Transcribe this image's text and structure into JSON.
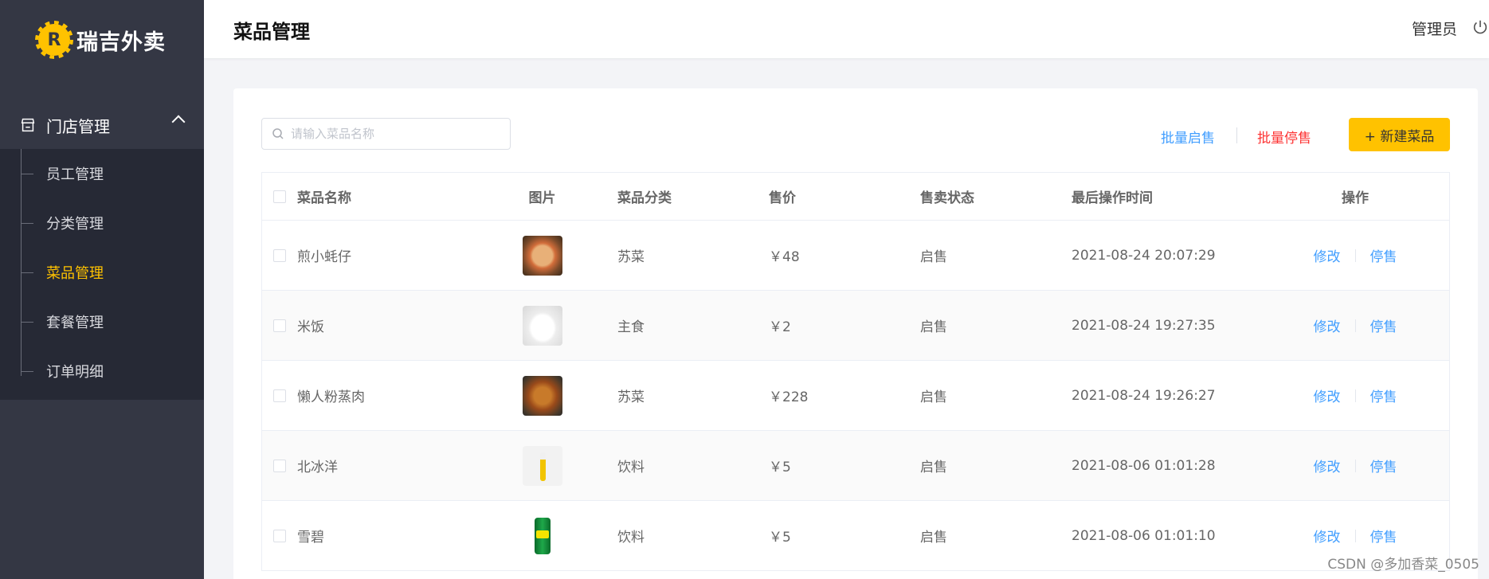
{
  "brand": {
    "logo_char": "R",
    "name": "瑞吉外卖"
  },
  "sidebar": {
    "group_label": "门店管理",
    "items": [
      {
        "label": "员工管理",
        "active": false
      },
      {
        "label": "分类管理",
        "active": false
      },
      {
        "label": "菜品管理",
        "active": true
      },
      {
        "label": "套餐管理",
        "active": false
      },
      {
        "label": "订单明细",
        "active": false
      }
    ]
  },
  "header": {
    "title": "菜品管理",
    "user": "管理员"
  },
  "toolbar": {
    "search_placeholder": "请输入菜品名称",
    "batch_enable": "批量启售",
    "batch_disable": "批量停售",
    "new_button": "+ 新建菜品"
  },
  "table": {
    "columns": [
      "菜品名称",
      "图片",
      "菜品分类",
      "售价",
      "售卖状态",
      "最后操作时间",
      "操作"
    ],
    "rows": [
      {
        "name": "煎小蚝仔",
        "image": "dish-photo",
        "category": "苏菜",
        "price": "￥48",
        "status": "启售",
        "time": "2021-08-24 20:07:29",
        "edit": "修改",
        "toggle": "停售"
      },
      {
        "name": "米饭",
        "image": "rice-photo",
        "category": "主食",
        "price": "￥2",
        "status": "启售",
        "time": "2021-08-24 19:27:35",
        "edit": "修改",
        "toggle": "停售"
      },
      {
        "name": "懒人粉蒸肉",
        "image": "dish-photo",
        "category": "苏菜",
        "price": "￥228",
        "status": "启售",
        "time": "2021-08-24 19:26:27",
        "edit": "修改",
        "toggle": "停售"
      },
      {
        "name": "北冰洋",
        "image": "drink-photo",
        "category": "饮料",
        "price": "￥5",
        "status": "启售",
        "time": "2021-08-06 01:01:28",
        "edit": "修改",
        "toggle": "停售"
      },
      {
        "name": "雪碧",
        "image": "can-photo",
        "category": "饮料",
        "price": "￥5",
        "status": "启售",
        "time": "2021-08-06 01:01:10",
        "edit": "修改",
        "toggle": "停售"
      }
    ]
  },
  "watermark": "CSDN @多加香菜_0505",
  "colors": {
    "accent": "#ffc200",
    "link": "#419eff",
    "danger": "#fd3333",
    "sidebar": "#343744",
    "submenu": "#262935"
  }
}
